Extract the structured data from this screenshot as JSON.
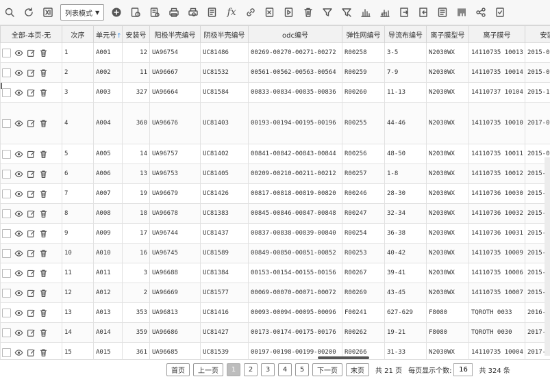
{
  "toolbar": {
    "mode_label": "列表模式",
    "icons": [
      "search-icon",
      "refresh-icon",
      "excel-icon",
      "add-icon",
      "edit-doc-icon",
      "copy-doc-icon",
      "print-icon",
      "print-preview-icon",
      "doc-settings-icon",
      "fx-icon",
      "link-icon",
      "export-icon",
      "import-icon",
      "delete-icon",
      "filter-icon",
      "clear-filter-icon",
      "bar-chart-icon",
      "stacked-chart-icon",
      "export-file-icon",
      "import-file-icon",
      "report-icon",
      "barcode-icon",
      "share-icon",
      "check-doc-icon"
    ],
    "fx_label": "fx"
  },
  "table": {
    "headers": {
      "select": "全部-本页-无",
      "seq": "次序",
      "unit": "单元号",
      "qty": "安装号",
      "anode": "阳极半壳编号",
      "cathode": "阴极半壳编号",
      "odc": "odc编号",
      "elastic": "弹性网编号",
      "flow": "导流布编号",
      "membrane_model": "离子膜型号",
      "membrane_no": "离子膜号",
      "install": "安装"
    },
    "sort_indicator": "↑",
    "rows": [
      {
        "seq": "1",
        "unit": "A001",
        "qty": "12",
        "anode": "UA96754",
        "cathode": "UC81486",
        "odc": "00269-00270-00271-00272",
        "elastic": "R00258",
        "flow": "3-5",
        "model": "N2030WX",
        "membrane": "14110735 10013",
        "install": "2015-0"
      },
      {
        "seq": "2",
        "unit": "A002",
        "qty": "11",
        "anode": "UA96667",
        "cathode": "UC81532",
        "odc": "00561-00562-00563-00564",
        "elastic": "R00259",
        "flow": "7-9",
        "model": "N2030WX",
        "membrane": "14110735 10014",
        "install": "2015-0"
      },
      {
        "seq": "3",
        "unit": "A003",
        "qty": "327",
        "anode": "UA96664",
        "cathode": "UC81584",
        "odc": "00833-00834-00835-00836",
        "elastic": "R00260",
        "flow": "11-13",
        "model": "N2030WX",
        "membrane": "14110737 10104",
        "install": "2015-1"
      },
      {
        "seq": "4",
        "unit": "A004",
        "qty": "360",
        "anode": "UA96676",
        "cathode": "UC81403",
        "odc": "00193-00194-00195-00196",
        "elastic": "R00255",
        "flow": "44-46",
        "model": "N2030WX",
        "membrane": "14110735 10010",
        "install": "2017-0"
      },
      {
        "seq": "5",
        "unit": "A005",
        "qty": "14",
        "anode": "UA96757",
        "cathode": "UC81402",
        "odc": "00841-00842-00843-00844",
        "elastic": "R00256",
        "flow": "48-50",
        "model": "N2030WX",
        "membrane": "14110735 10011",
        "install": "2015-0"
      },
      {
        "seq": "6",
        "unit": "A006",
        "qty": "13",
        "anode": "UA96753",
        "cathode": "UC81405",
        "odc": "00209-00210-00211-00212",
        "elastic": "R00257",
        "flow": "1-8",
        "model": "N2030WX",
        "membrane": "14110735 10012",
        "install": "2015-"
      },
      {
        "seq": "7",
        "unit": "A007",
        "qty": "19",
        "anode": "UA96679",
        "cathode": "UC81426",
        "odc": "00817-00818-00819-00820",
        "elastic": "R00246",
        "flow": "28-30",
        "model": "N2030WX",
        "membrane": "14110736 10030",
        "install": "2015-"
      },
      {
        "seq": "8",
        "unit": "A008",
        "qty": "18",
        "anode": "UA96678",
        "cathode": "UC81383",
        "odc": "00845-00846-00847-00848",
        "elastic": "R00247",
        "flow": "32-34",
        "model": "N2030WX",
        "membrane": "14110736 10032",
        "install": "2015-"
      },
      {
        "seq": "9",
        "unit": "A009",
        "qty": "17",
        "anode": "UA96744",
        "cathode": "UC81437",
        "odc": "00837-00838-00839-00840",
        "elastic": "R00254",
        "flow": "36-38",
        "model": "N2030WX",
        "membrane": "14110736 10031",
        "install": "2015-"
      },
      {
        "seq": "10",
        "unit": "A010",
        "qty": "16",
        "anode": "UA96745",
        "cathode": "UC81589",
        "odc": "00849-00850-00851-00852",
        "elastic": "R00253",
        "flow": "40-42",
        "model": "N2030WX",
        "membrane": "14110735 10009",
        "install": "2015-"
      },
      {
        "seq": "11",
        "unit": "A011",
        "qty": "3",
        "anode": "UA96688",
        "cathode": "UC81384",
        "odc": "00153-00154-00155-00156",
        "elastic": "R00267",
        "flow": "39-41",
        "model": "N2030WX",
        "membrane": "14110735 10006",
        "install": "2015-"
      },
      {
        "seq": "12",
        "unit": "A012",
        "qty": "2",
        "anode": "UA96669",
        "cathode": "UC81577",
        "odc": "00069-00070-00071-00072",
        "elastic": "R00269",
        "flow": "43-45",
        "model": "N2030WX",
        "membrane": "14110735 10007",
        "install": "2015-"
      },
      {
        "seq": "13",
        "unit": "A013",
        "qty": "353",
        "anode": "UA96813",
        "cathode": "UC81416",
        "odc": "00093-00094-00095-00096",
        "elastic": "F00241",
        "flow": "627-629",
        "model": "F8080",
        "membrane": "TQROTH 0033",
        "install": "2016-"
      },
      {
        "seq": "14",
        "unit": "A014",
        "qty": "359",
        "anode": "UA96686",
        "cathode": "UC81427",
        "odc": "00173-00174-00175-00176",
        "elastic": "R00262",
        "flow": "19-21",
        "model": "F8080",
        "membrane": "TQROTH 0030",
        "install": "2017-"
      },
      {
        "seq": "15",
        "unit": "A015",
        "qty": "361",
        "anode": "UA96685",
        "cathode": "UC81539",
        "odc": "00197-00198-00199-00200",
        "elastic": "R00266",
        "flow": "31-33",
        "model": "N2030WX",
        "membrane": "14110735 10004",
        "install": "2017-"
      }
    ]
  },
  "pager": {
    "first": "首页",
    "prev": "上一页",
    "pages": [
      "1",
      "2",
      "3",
      "4",
      "5"
    ],
    "current": "1",
    "next": "下一页",
    "last": "末页",
    "total_pages": "共 21 页",
    "per_page_label": "每页显示个数:",
    "per_page_value": "16",
    "total_items": "共 324 条"
  }
}
